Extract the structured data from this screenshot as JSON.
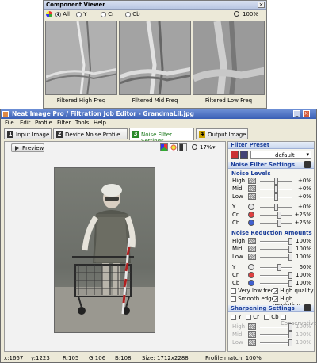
{
  "component_viewer": {
    "title": "Component Viewer",
    "channels": [
      "All",
      "Y",
      "Cr",
      "Cb"
    ],
    "zoom": "100%",
    "panels": [
      "Filtered High Freq",
      "Filtered Mid Freq",
      "Filtered Low Freq"
    ]
  },
  "main": {
    "title": "Neat Image Pro / Filtration Job Editor - GrandmaLil.jpg",
    "menu": [
      "File",
      "Edit",
      "Profile",
      "Filter",
      "Tools",
      "Help"
    ],
    "tabs": [
      {
        "num": "1",
        "label": "Input Image"
      },
      {
        "num": "2",
        "label": "Device Noise Profile"
      },
      {
        "num": "3",
        "label": "Noise Filter Settings"
      },
      {
        "num": "4",
        "label": "Output Image"
      }
    ],
    "preview_label": "Preview",
    "zoom": "17%"
  },
  "filter_preset": {
    "title": "Filter Preset",
    "value": "default"
  },
  "noise_filter_settings": {
    "title": "Noise Filter Settings",
    "levels_title": "Noise Levels",
    "levels": [
      {
        "label": "High",
        "value": "+0%",
        "pos": 0.5
      },
      {
        "label": "Mid",
        "value": "+0%",
        "pos": 0.5
      },
      {
        "label": "Low",
        "value": "+0%",
        "pos": 0.5
      },
      {
        "label": "Y",
        "value": "+0%",
        "pos": 0.5
      },
      {
        "label": "Cr",
        "value": "+25%",
        "pos": 0.62
      },
      {
        "label": "Cb",
        "value": "+25%",
        "pos": 0.62
      }
    ],
    "reduction_title": "Noise Reduction Amounts",
    "reduction": [
      {
        "label": "High",
        "value": "100%",
        "pos": 1.0
      },
      {
        "label": "Mid",
        "value": "100%",
        "pos": 1.0
      },
      {
        "label": "Low",
        "value": "100%",
        "pos": 1.0
      },
      {
        "label": "Y",
        "value": "60%",
        "pos": 0.6
      },
      {
        "label": "Cr",
        "value": "100%",
        "pos": 1.0
      },
      {
        "label": "Cb",
        "value": "100%",
        "pos": 1.0
      }
    ],
    "options": [
      {
        "label": "Very low freq",
        "checked": false
      },
      {
        "label": "High quality",
        "checked": true
      },
      {
        "label": "Smooth edges",
        "checked": false
      },
      {
        "label": "High resolution",
        "checked": true
      }
    ]
  },
  "sharpening": {
    "title": "Sharpening Settings",
    "channels": [
      "Y",
      "Cr",
      "Cb"
    ],
    "conservative": "Conservative",
    "rows": [
      {
        "label": "High",
        "value": "100%"
      },
      {
        "label": "Mid",
        "value": "100%"
      },
      {
        "label": "Low",
        "value": "100%"
      }
    ]
  },
  "status": {
    "x": "x:1667",
    "y": "y:1223",
    "r": "R:105",
    "g": "G:106",
    "b": "B:108",
    "size": "Size: 1712x2288",
    "match": "Profile match: 100%"
  }
}
